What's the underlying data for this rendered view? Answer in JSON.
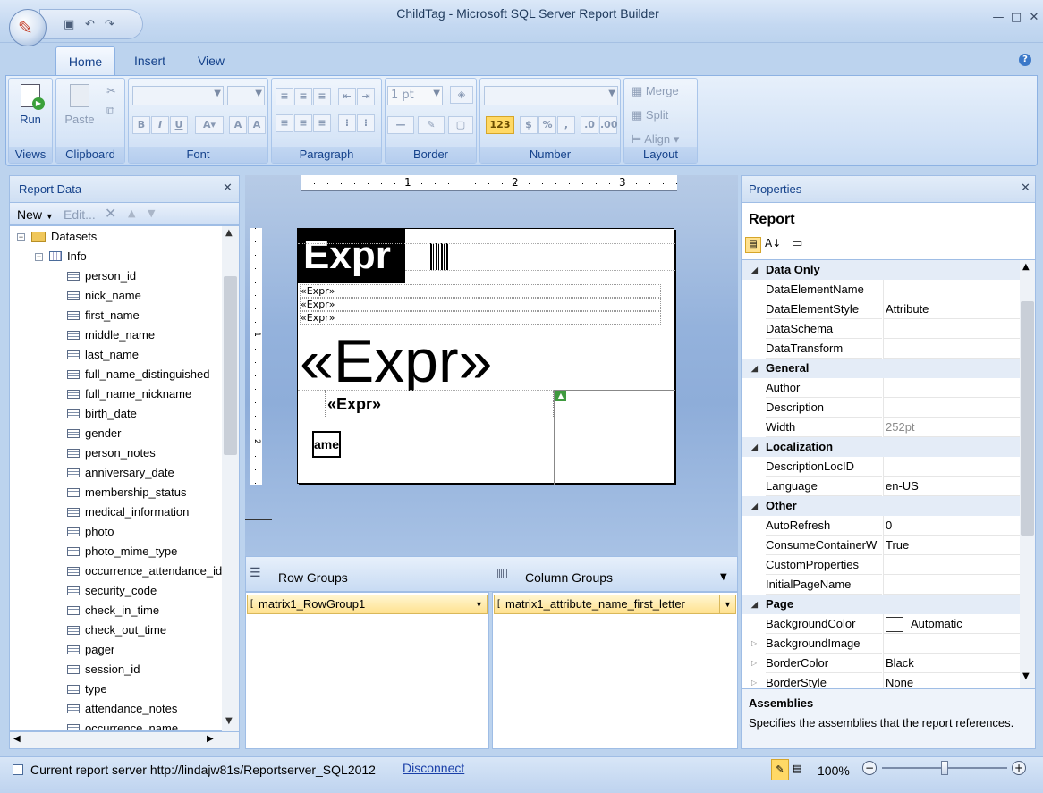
{
  "window": {
    "title": "ChildTag - Microsoft SQL Server Report Builder"
  },
  "ribbon": {
    "tabs": [
      "Home",
      "Insert",
      "View"
    ],
    "groups": {
      "views": {
        "label": "Views",
        "run": "Run"
      },
      "clipboard": {
        "label": "Clipboard",
        "paste": "Paste"
      },
      "font": {
        "label": "Font"
      },
      "paragraph": {
        "label": "Paragraph"
      },
      "border": {
        "label": "Border",
        "width": "1 pt"
      },
      "number": {
        "label": "Number"
      },
      "layout": {
        "label": "Layout",
        "merge": "Merge",
        "split": "Split",
        "align": "Align"
      }
    }
  },
  "report_data": {
    "title": "Report Data",
    "toolbar": {
      "new": "New",
      "edit": "Edit..."
    },
    "datasets_label": "Datasets",
    "dataset_name": "Info",
    "fields": [
      "person_id",
      "nick_name",
      "first_name",
      "middle_name",
      "last_name",
      "full_name_distinguished",
      "full_name_nickname",
      "birth_date",
      "gender",
      "person_notes",
      "anniversary_date",
      "membership_status",
      "medical_information",
      "photo",
      "photo_mime_type",
      "occurrence_attendance_id",
      "security_code",
      "check_in_time",
      "check_out_time",
      "pager",
      "session_id",
      "type",
      "attendance_notes",
      "occurrence_name"
    ]
  },
  "design": {
    "ruler_marks": [
      "1",
      "2",
      "3"
    ],
    "ruler_left_marks": [
      "1",
      "2"
    ],
    "expr_big": "Expr",
    "expr_small": [
      "«Expr»",
      "«Expr»",
      "«Expr»"
    ],
    "expr_large": "«Expr»",
    "expr_bold": "«Expr»",
    "small_box": "ame"
  },
  "groups": {
    "row_label": "Row Groups",
    "column_label": "Column Groups",
    "row_item": "matrix1_RowGroup1",
    "column_item": "matrix1_attribute_name_first_letter"
  },
  "properties": {
    "title": "Properties",
    "object": "Report",
    "rows": [
      {
        "cat": "Data Only"
      },
      {
        "name": "DataElementName",
        "value": ""
      },
      {
        "name": "DataElementStyle",
        "value": "Attribute"
      },
      {
        "name": "DataSchema",
        "value": ""
      },
      {
        "name": "DataTransform",
        "value": ""
      },
      {
        "cat": "General"
      },
      {
        "name": "Author",
        "value": ""
      },
      {
        "name": "Description",
        "value": ""
      },
      {
        "name": "Width",
        "value": "252pt",
        "dim": true
      },
      {
        "cat": "Localization"
      },
      {
        "name": "DescriptionLocID",
        "value": ""
      },
      {
        "name": "Language",
        "value": "en-US"
      },
      {
        "cat": "Other"
      },
      {
        "name": "AutoRefresh",
        "value": "0"
      },
      {
        "name": "ConsumeContainerW",
        "value": "True"
      },
      {
        "name": "CustomProperties",
        "value": ""
      },
      {
        "name": "InitialPageName",
        "value": ""
      },
      {
        "cat": "Page"
      },
      {
        "name": "BackgroundColor",
        "value": "Automatic",
        "swatch": true
      },
      {
        "name": "BackgroundImage",
        "value": "",
        "sub": true
      },
      {
        "name": "BorderColor",
        "value": "Black",
        "sub": true
      },
      {
        "name": "BorderStyle",
        "value": "None",
        "sub": true
      }
    ],
    "desc_title": "Assemblies",
    "desc_text": "Specifies the assemblies that the report references."
  },
  "status": {
    "server_text": "Current report server http://lindajw81s/Reportserver_SQL2012",
    "disconnect": "Disconnect",
    "zoom": "100%",
    "zoom_level": 0.5
  },
  "colors": {
    "accent": "#15428b",
    "selection": "#ffe18f"
  }
}
